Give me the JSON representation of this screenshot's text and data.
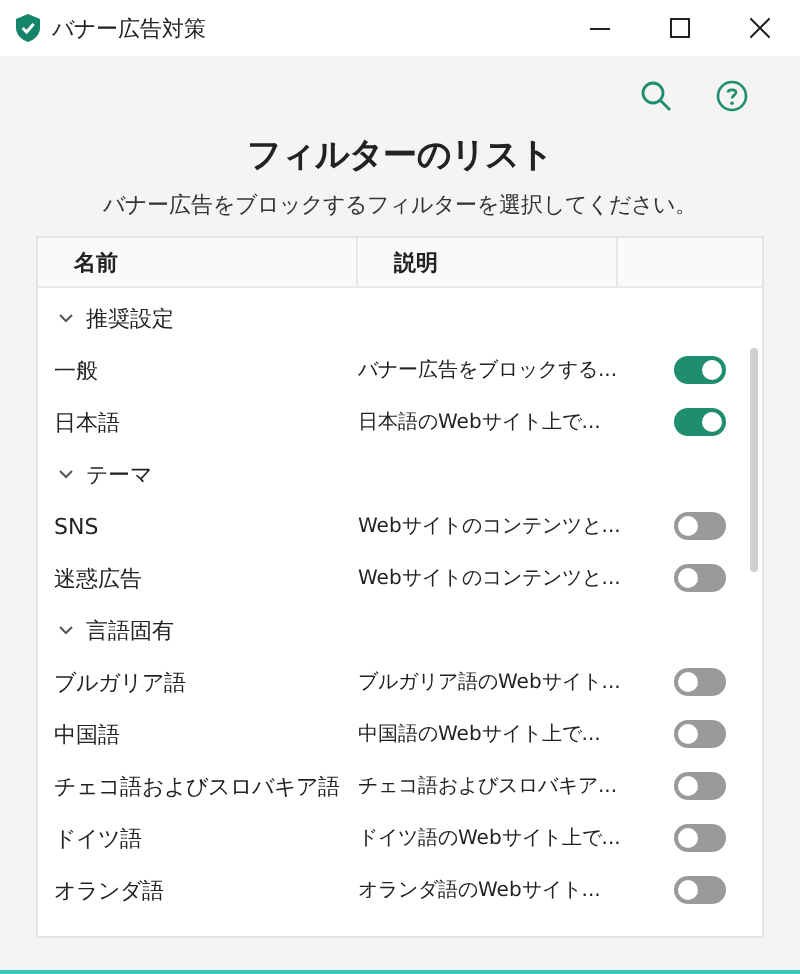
{
  "window": {
    "title": "バナー広告対策"
  },
  "heading": "フィルターのリスト",
  "subtitle": "バナー広告をブロックするフィルターを選択してください。",
  "table": {
    "columns": [
      "名前",
      "説明"
    ],
    "groups": [
      {
        "name": "推奨設定",
        "expanded": true,
        "rows": [
          {
            "name": "一般",
            "description": "バナー広告をブロックする...",
            "on": true
          },
          {
            "name": "日本語",
            "description": "日本語のWebサイト上で...",
            "on": true
          }
        ]
      },
      {
        "name": "テーマ",
        "expanded": true,
        "rows": [
          {
            "name": "SNS",
            "description": "Webサイトのコンテンツと...",
            "on": false
          },
          {
            "name": "迷惑広告",
            "description": "Webサイトのコンテンツと...",
            "on": false
          }
        ]
      },
      {
        "name": "言語固有",
        "expanded": true,
        "rows": [
          {
            "name": "ブルガリア語",
            "description": "ブルガリア語のWebサイト...",
            "on": false
          },
          {
            "name": "中国語",
            "description": "中国語のWebサイト上で...",
            "on": false
          },
          {
            "name": "チェコ語およびスロバキア語",
            "description": "チェコ語およびスロバキア...",
            "on": false
          },
          {
            "name": "ドイツ語",
            "description": "ドイツ語のWebサイト上で...",
            "on": false
          },
          {
            "name": "オランダ語",
            "description": "オランダ語のWebサイト...",
            "on": false
          }
        ]
      }
    ]
  }
}
